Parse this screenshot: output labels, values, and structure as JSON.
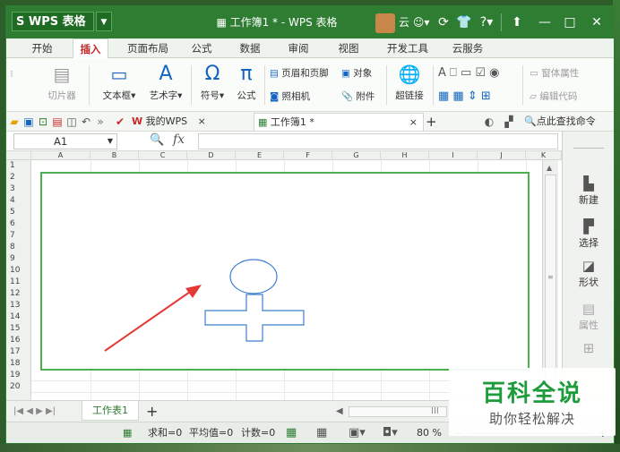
{
  "titlebar": {
    "app_name": "WPS 表格",
    "logo_text": "S WPS 表格",
    "logo_dropdown": "▼",
    "document_title": "工作簿1 * - WPS 表格",
    "cloud_label": "云",
    "help_label": "?",
    "minimize": "—",
    "restore": "□",
    "close": "✕"
  },
  "menu": {
    "tabs": [
      "开始",
      "插入",
      "页面布局",
      "公式",
      "数据",
      "审阅",
      "视图",
      "开发工具",
      "云服务"
    ],
    "active": "插入"
  },
  "ribbon": {
    "clipart": "切片器",
    "textbox": "文本框",
    "wordart": "艺术字",
    "symbol": "符号",
    "formula": "公式",
    "header_footer": "页眉和页脚",
    "object": "对象",
    "camera": "照相机",
    "attachment": "附件",
    "hyperlink": "超链接",
    "window_props": "窗体属性",
    "edit_code": "编辑代码",
    "dropdown_caret": "▾"
  },
  "quickbar": {
    "mywps_tab": "我的WPS",
    "doc_tab": "工作簿1 *",
    "close_x": "×",
    "new_tab": "+",
    "search_hint": "点此查找命令"
  },
  "formula_bar": {
    "cell_ref": "A1",
    "fx": "fx"
  },
  "grid": {
    "columns": [
      "A",
      "B",
      "C",
      "D",
      "E",
      "F",
      "G",
      "H",
      "I",
      "J",
      "K"
    ],
    "rows": [
      "1",
      "2",
      "3",
      "4",
      "5",
      "6",
      "7",
      "8",
      "9",
      "10",
      "11",
      "12",
      "13",
      "14",
      "15",
      "16",
      "17",
      "18",
      "19",
      "20"
    ]
  },
  "taskpane": {
    "items": [
      "新建",
      "选择",
      "形状",
      "属性"
    ]
  },
  "sheets": {
    "tabs": [
      "工作表1"
    ],
    "add": "+"
  },
  "status": {
    "sum": "求和=0",
    "average": "平均值=0",
    "count": "计数=0",
    "zoom": "80 %"
  },
  "watermark": {
    "title": "百科全说",
    "subtitle": "助你轻松解决"
  },
  "colors": {
    "title_bar": "#2e7d32",
    "canvas_border": "#4caf50",
    "arrow": "#e53935",
    "shape_stroke": "#3d7fd1",
    "watermark_green": "#1e9c3c"
  }
}
